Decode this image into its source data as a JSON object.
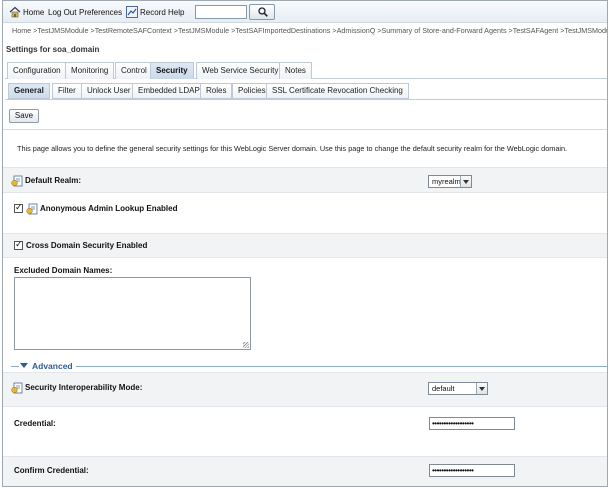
{
  "toolbar": {
    "home": "Home",
    "logout": "Log Out",
    "preferences": "Preferences",
    "record": "Record",
    "help": "Help",
    "search_value": ""
  },
  "breadcrumb": "Home >TestJMSModule >TestRemoteSAFContext >TestJMSModule >TestSAFImportedDestinations >AdmissionQ >Summary of Store-and-Forward Agents >TestSAFAgent >TestJMSModule",
  "settings_title": "Settings for soa_domain",
  "tabs": [
    "Configuration",
    "Monitoring",
    "Control",
    "Security",
    "Web Service Security",
    "Notes"
  ],
  "active_tab": "Security",
  "subtabs": [
    "General",
    "Filter",
    "Unlock User",
    "Embedded LDAP",
    "Roles",
    "Policies",
    "SSL Certificate Revocation Checking"
  ],
  "active_subtab": "General",
  "save_label": "Save",
  "description": "This page allows you to define the general security settings for this WebLogic Server domain. Use this page to change the default security realm for the WebLogic domain.",
  "fields": {
    "default_realm_label": "Default Realm:",
    "default_realm_value": "myrealm",
    "anon_admin_label": "Anonymous Admin Lookup Enabled",
    "anon_admin_checked": true,
    "cross_domain_label": "Cross Domain Security Enabled",
    "cross_domain_checked": true,
    "excluded_label": "Excluded Domain Names:",
    "excluded_value": "",
    "advanced_label": "Advanced",
    "interop_label": "Security Interoperability Mode:",
    "interop_value": "default",
    "credential_label": "Credential:",
    "credential_value": "••••••••••••••••••",
    "confirm_label": "Confirm Credential:",
    "confirm_value": "••••••••••••••••••"
  },
  "colors": {
    "accent": "#2d5c95",
    "tab_active": "#cddceb",
    "row_shade": "#f1f3f5"
  }
}
